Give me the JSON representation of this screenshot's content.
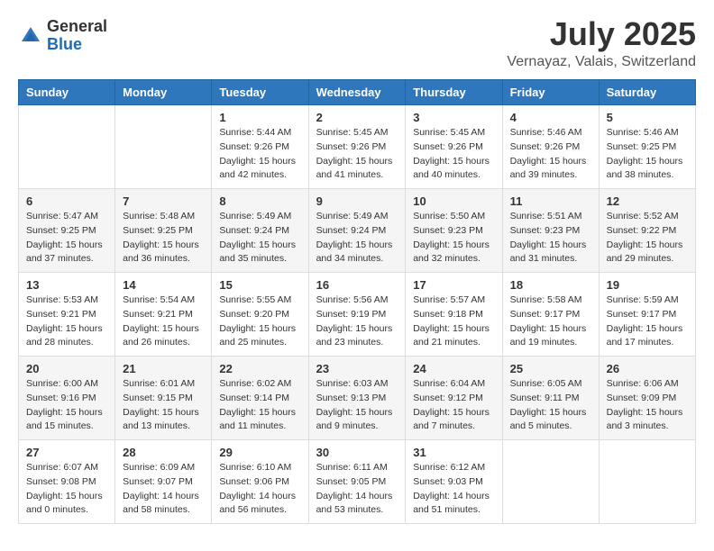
{
  "header": {
    "logo_general": "General",
    "logo_blue": "Blue",
    "month": "July 2025",
    "location": "Vernayaz, Valais, Switzerland"
  },
  "weekdays": [
    "Sunday",
    "Monday",
    "Tuesday",
    "Wednesday",
    "Thursday",
    "Friday",
    "Saturday"
  ],
  "weeks": [
    [
      {
        "day": "",
        "info": ""
      },
      {
        "day": "",
        "info": ""
      },
      {
        "day": "1",
        "info": "Sunrise: 5:44 AM\nSunset: 9:26 PM\nDaylight: 15 hours\nand 42 minutes."
      },
      {
        "day": "2",
        "info": "Sunrise: 5:45 AM\nSunset: 9:26 PM\nDaylight: 15 hours\nand 41 minutes."
      },
      {
        "day": "3",
        "info": "Sunrise: 5:45 AM\nSunset: 9:26 PM\nDaylight: 15 hours\nand 40 minutes."
      },
      {
        "day": "4",
        "info": "Sunrise: 5:46 AM\nSunset: 9:26 PM\nDaylight: 15 hours\nand 39 minutes."
      },
      {
        "day": "5",
        "info": "Sunrise: 5:46 AM\nSunset: 9:25 PM\nDaylight: 15 hours\nand 38 minutes."
      }
    ],
    [
      {
        "day": "6",
        "info": "Sunrise: 5:47 AM\nSunset: 9:25 PM\nDaylight: 15 hours\nand 37 minutes."
      },
      {
        "day": "7",
        "info": "Sunrise: 5:48 AM\nSunset: 9:25 PM\nDaylight: 15 hours\nand 36 minutes."
      },
      {
        "day": "8",
        "info": "Sunrise: 5:49 AM\nSunset: 9:24 PM\nDaylight: 15 hours\nand 35 minutes."
      },
      {
        "day": "9",
        "info": "Sunrise: 5:49 AM\nSunset: 9:24 PM\nDaylight: 15 hours\nand 34 minutes."
      },
      {
        "day": "10",
        "info": "Sunrise: 5:50 AM\nSunset: 9:23 PM\nDaylight: 15 hours\nand 32 minutes."
      },
      {
        "day": "11",
        "info": "Sunrise: 5:51 AM\nSunset: 9:23 PM\nDaylight: 15 hours\nand 31 minutes."
      },
      {
        "day": "12",
        "info": "Sunrise: 5:52 AM\nSunset: 9:22 PM\nDaylight: 15 hours\nand 29 minutes."
      }
    ],
    [
      {
        "day": "13",
        "info": "Sunrise: 5:53 AM\nSunset: 9:21 PM\nDaylight: 15 hours\nand 28 minutes."
      },
      {
        "day": "14",
        "info": "Sunrise: 5:54 AM\nSunset: 9:21 PM\nDaylight: 15 hours\nand 26 minutes."
      },
      {
        "day": "15",
        "info": "Sunrise: 5:55 AM\nSunset: 9:20 PM\nDaylight: 15 hours\nand 25 minutes."
      },
      {
        "day": "16",
        "info": "Sunrise: 5:56 AM\nSunset: 9:19 PM\nDaylight: 15 hours\nand 23 minutes."
      },
      {
        "day": "17",
        "info": "Sunrise: 5:57 AM\nSunset: 9:18 PM\nDaylight: 15 hours\nand 21 minutes."
      },
      {
        "day": "18",
        "info": "Sunrise: 5:58 AM\nSunset: 9:17 PM\nDaylight: 15 hours\nand 19 minutes."
      },
      {
        "day": "19",
        "info": "Sunrise: 5:59 AM\nSunset: 9:17 PM\nDaylight: 15 hours\nand 17 minutes."
      }
    ],
    [
      {
        "day": "20",
        "info": "Sunrise: 6:00 AM\nSunset: 9:16 PM\nDaylight: 15 hours\nand 15 minutes."
      },
      {
        "day": "21",
        "info": "Sunrise: 6:01 AM\nSunset: 9:15 PM\nDaylight: 15 hours\nand 13 minutes."
      },
      {
        "day": "22",
        "info": "Sunrise: 6:02 AM\nSunset: 9:14 PM\nDaylight: 15 hours\nand 11 minutes."
      },
      {
        "day": "23",
        "info": "Sunrise: 6:03 AM\nSunset: 9:13 PM\nDaylight: 15 hours\nand 9 minutes."
      },
      {
        "day": "24",
        "info": "Sunrise: 6:04 AM\nSunset: 9:12 PM\nDaylight: 15 hours\nand 7 minutes."
      },
      {
        "day": "25",
        "info": "Sunrise: 6:05 AM\nSunset: 9:11 PM\nDaylight: 15 hours\nand 5 minutes."
      },
      {
        "day": "26",
        "info": "Sunrise: 6:06 AM\nSunset: 9:09 PM\nDaylight: 15 hours\nand 3 minutes."
      }
    ],
    [
      {
        "day": "27",
        "info": "Sunrise: 6:07 AM\nSunset: 9:08 PM\nDaylight: 15 hours\nand 0 minutes."
      },
      {
        "day": "28",
        "info": "Sunrise: 6:09 AM\nSunset: 9:07 PM\nDaylight: 14 hours\nand 58 minutes."
      },
      {
        "day": "29",
        "info": "Sunrise: 6:10 AM\nSunset: 9:06 PM\nDaylight: 14 hours\nand 56 minutes."
      },
      {
        "day": "30",
        "info": "Sunrise: 6:11 AM\nSunset: 9:05 PM\nDaylight: 14 hours\nand 53 minutes."
      },
      {
        "day": "31",
        "info": "Sunrise: 6:12 AM\nSunset: 9:03 PM\nDaylight: 14 hours\nand 51 minutes."
      },
      {
        "day": "",
        "info": ""
      },
      {
        "day": "",
        "info": ""
      }
    ]
  ]
}
